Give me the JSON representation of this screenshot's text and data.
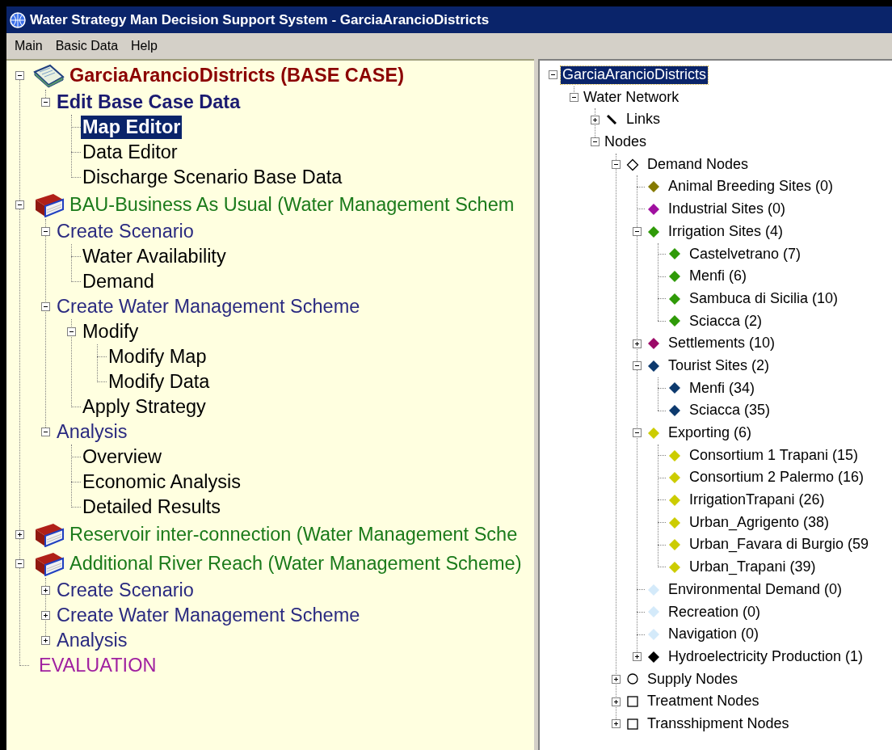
{
  "window": {
    "title": "Water Strategy Man Decision Support System - GarciaArancioDistricts"
  },
  "menu": [
    "Main",
    "Basic Data",
    "Help"
  ],
  "left_tree": [
    {
      "label": "GarciaArancioDistricts (BASE CASE)",
      "kind": "project",
      "expanded": true,
      "selected": false,
      "children": [
        {
          "label": "Edit Base Case Data",
          "kind": "base-group",
          "expanded": true,
          "selected": false,
          "children": [
            {
              "label": "Map Editor",
              "kind": "item",
              "selected": true
            },
            {
              "label": "Data Editor",
              "kind": "item",
              "selected": false
            },
            {
              "label": "Discharge Scenario Base Data",
              "kind": "item",
              "selected": false
            }
          ]
        }
      ]
    },
    {
      "label": "BAU-Business As Usual (Water Management Schem",
      "kind": "scheme",
      "expanded": true,
      "selected": false,
      "children": [
        {
          "label": "Create Scenario",
          "kind": "group",
          "expanded": true,
          "selected": false,
          "children": [
            {
              "label": "Water Availability",
              "kind": "item",
              "selected": false
            },
            {
              "label": "Demand",
              "kind": "item",
              "selected": false
            }
          ]
        },
        {
          "label": "Create Water Management Scheme",
          "kind": "group",
          "expanded": true,
          "selected": false,
          "children": [
            {
              "label": "Modify",
              "kind": "item",
              "expanded": true,
              "selected": false,
              "children": [
                {
                  "label": "Modify Map",
                  "kind": "item",
                  "selected": false
                },
                {
                  "label": "Modify Data",
                  "kind": "item",
                  "selected": false
                }
              ]
            },
            {
              "label": "Apply Strategy",
              "kind": "item",
              "selected": false
            }
          ]
        },
        {
          "label": "Analysis",
          "kind": "group",
          "expanded": true,
          "selected": false,
          "children": [
            {
              "label": "Overview",
              "kind": "item",
              "selected": false
            },
            {
              "label": "Economic Analysis",
              "kind": "item",
              "selected": false
            },
            {
              "label": "Detailed Results",
              "kind": "item",
              "selected": false
            }
          ]
        }
      ]
    },
    {
      "label": "Reservoir inter-connection (Water Management Sche",
      "kind": "scheme",
      "expanded": false,
      "selected": false
    },
    {
      "label": "Additional River Reach (Water Management Scheme)",
      "kind": "scheme",
      "expanded": true,
      "selected": false,
      "children": [
        {
          "label": "Create Scenario",
          "kind": "group",
          "expanded": false,
          "selected": false
        },
        {
          "label": "Create Water Management Scheme",
          "kind": "group",
          "expanded": false,
          "selected": false
        },
        {
          "label": "Analysis",
          "kind": "group",
          "expanded": false,
          "selected": false
        }
      ]
    },
    {
      "label": "EVALUATION",
      "kind": "evaluation",
      "selected": false
    }
  ],
  "right_tree": [
    {
      "label": "GarciaArancioDistricts",
      "expanded": true,
      "selected": true,
      "children": [
        {
          "label": "Water Network",
          "expanded": true,
          "selected": false,
          "children": [
            {
              "label": "Links",
              "kind": "line",
              "expanded": false,
              "selected": false
            },
            {
              "label": "Nodes",
              "expanded": true,
              "selected": false,
              "children": [
                {
                  "label": "Demand Nodes",
                  "kind": "diamond-outline",
                  "expanded": true,
                  "selected": false,
                  "children": [
                    {
                      "label": "Animal Breeding Sites (0)",
                      "kind": "diamond",
                      "color": "#857a00",
                      "selected": false
                    },
                    {
                      "label": "Industrial Sites (0)",
                      "kind": "diamond",
                      "color": "#a010a0",
                      "selected": false
                    },
                    {
                      "label": "Irrigation Sites (4)",
                      "kind": "diamond",
                      "color": "#2f9a08",
                      "expanded": true,
                      "selected": false,
                      "children": [
                        {
                          "label": "Castelvetrano (7)",
                          "kind": "diamond",
                          "color": "#2f9a08",
                          "selected": false
                        },
                        {
                          "label": "Menfi (6)",
                          "kind": "diamond",
                          "color": "#2f9a08",
                          "selected": false
                        },
                        {
                          "label": "Sambuca di Sicilia (10)",
                          "kind": "diamond",
                          "color": "#2f9a08",
                          "selected": false
                        },
                        {
                          "label": "Sciacca (2)",
                          "kind": "diamond",
                          "color": "#2f9a08",
                          "selected": false
                        }
                      ]
                    },
                    {
                      "label": "Settlements (10)",
                      "kind": "diamond",
                      "color": "#9c0a68",
                      "expanded": false,
                      "selected": false
                    },
                    {
                      "label": "Tourist Sites (2)",
                      "kind": "diamond",
                      "color": "#0d3a6e",
                      "expanded": true,
                      "selected": false,
                      "children": [
                        {
                          "label": "Menfi (34)",
                          "kind": "diamond",
                          "color": "#0d3a6e",
                          "selected": false
                        },
                        {
                          "label": "Sciacca (35)",
                          "kind": "diamond",
                          "color": "#0d3a6e",
                          "selected": false
                        }
                      ]
                    },
                    {
                      "label": "Exporting (6)",
                      "kind": "diamond",
                      "color": "#cccc00",
                      "expanded": true,
                      "selected": false,
                      "children": [
                        {
                          "label": "Consortium 1 Trapani (15)",
                          "kind": "diamond",
                          "color": "#cccc00",
                          "selected": false
                        },
                        {
                          "label": "Consortium 2 Palermo (16)",
                          "kind": "diamond",
                          "color": "#cccc00",
                          "selected": false
                        },
                        {
                          "label": "IrrigationTrapani (26)",
                          "kind": "diamond",
                          "color": "#cccc00",
                          "selected": false
                        },
                        {
                          "label": "Urban_Agrigento (38)",
                          "kind": "diamond",
                          "color": "#cccc00",
                          "selected": false
                        },
                        {
                          "label": "Urban_Favara di Burgio (59",
                          "kind": "diamond",
                          "color": "#cccc00",
                          "selected": false
                        },
                        {
                          "label": "Urban_Trapani (39)",
                          "kind": "diamond",
                          "color": "#cccc00",
                          "selected": false
                        }
                      ]
                    },
                    {
                      "label": "Environmental Demand (0)",
                      "kind": "diamond",
                      "color": "#d4eafa",
                      "selected": false
                    },
                    {
                      "label": "Recreation (0)",
                      "kind": "diamond",
                      "color": "#d4eafa",
                      "selected": false
                    },
                    {
                      "label": "Navigation (0)",
                      "kind": "diamond",
                      "color": "#d4eafa",
                      "selected": false
                    },
                    {
                      "label": "Hydroelectricity Production (1)",
                      "kind": "diamond",
                      "color": "#000000",
                      "expanded": false,
                      "selected": false
                    }
                  ]
                },
                {
                  "label": "Supply Nodes",
                  "kind": "circle-outline",
                  "expanded": false,
                  "selected": false
                },
                {
                  "label": "Treatment Nodes",
                  "kind": "square-outline",
                  "expanded": false,
                  "selected": false
                },
                {
                  "label": "Transshipment Nodes",
                  "kind": "square-outline",
                  "expanded": false,
                  "selected": false
                }
              ]
            }
          ]
        }
      ]
    }
  ]
}
